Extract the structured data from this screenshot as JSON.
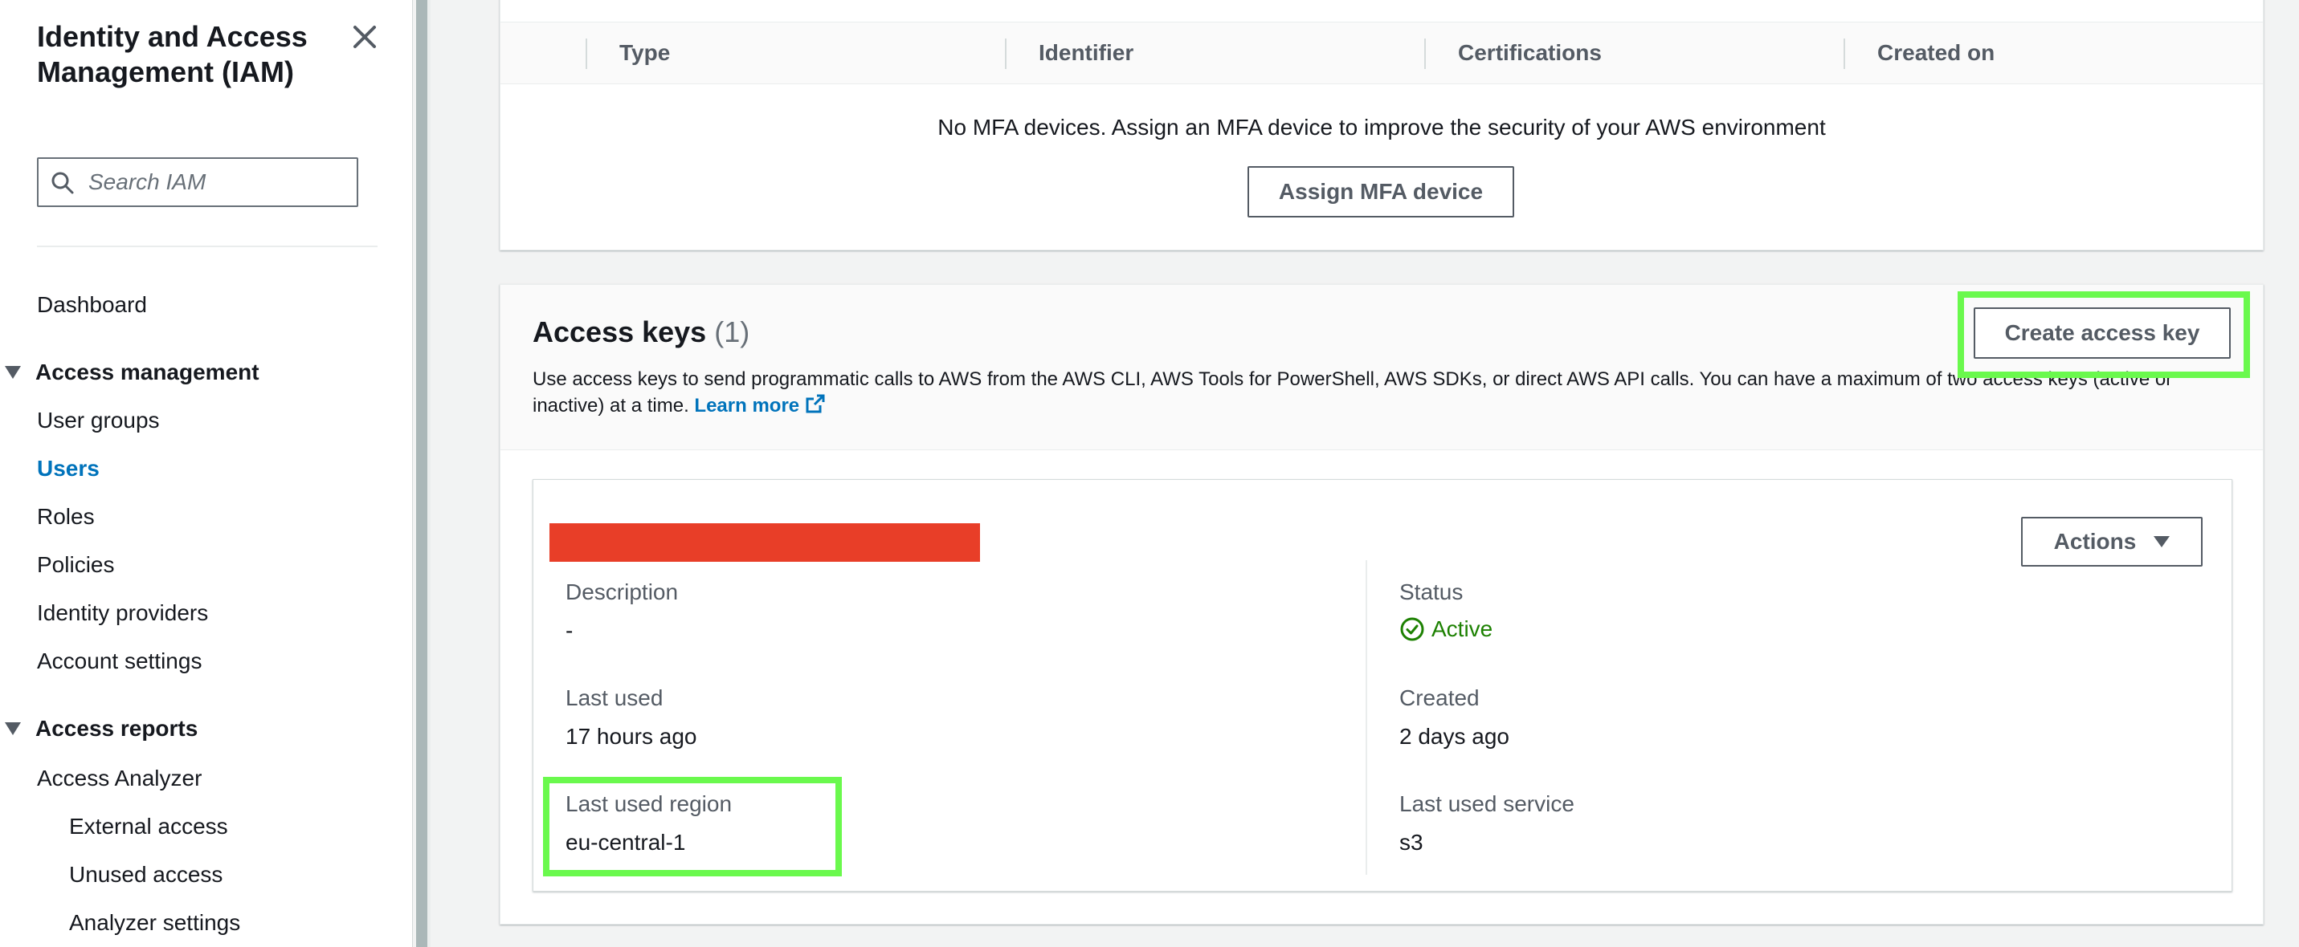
{
  "sidebar": {
    "title": "Identity and Access Management (IAM)",
    "search_placeholder": "Search IAM",
    "dashboard": "Dashboard",
    "access_management": {
      "label": "Access management",
      "items": [
        "User groups",
        "Users",
        "Roles",
        "Policies",
        "Identity providers",
        "Account settings"
      ],
      "active": "Users"
    },
    "access_reports": {
      "label": "Access reports",
      "analyzer": "Access Analyzer",
      "sub_items": [
        "External access",
        "Unused access",
        "Analyzer settings"
      ]
    }
  },
  "mfa": {
    "columns": [
      "Type",
      "Identifier",
      "Certifications",
      "Created on"
    ],
    "empty_message": "No MFA devices. Assign an MFA device to improve the security of your AWS environment",
    "assign_button": "Assign MFA device"
  },
  "access_keys": {
    "title": "Access keys",
    "count": "(1)",
    "description": "Use access keys to send programmatic calls to AWS from the AWS CLI, AWS Tools for PowerShell, AWS SDKs, or direct AWS API calls. You can have a maximum of two access keys (active or inactive) at a time.",
    "learn_more": "Learn more",
    "create_button": "Create access key",
    "key": {
      "actions_button": "Actions",
      "description_label": "Description",
      "description_value": "-",
      "status_label": "Status",
      "status_value": "Active",
      "last_used_label": "Last used",
      "last_used_value": "17 hours ago",
      "created_label": "Created",
      "created_value": "2 days ago",
      "last_used_region_label": "Last used region",
      "last_used_region_value": "eu-central-1",
      "last_used_service_label": "Last used service",
      "last_used_service_value": "s3"
    }
  },
  "colors": {
    "accent_link": "#0073bb",
    "status_active": "#1d8102",
    "highlight": "#6af94d",
    "redaction": "#e83e28"
  }
}
